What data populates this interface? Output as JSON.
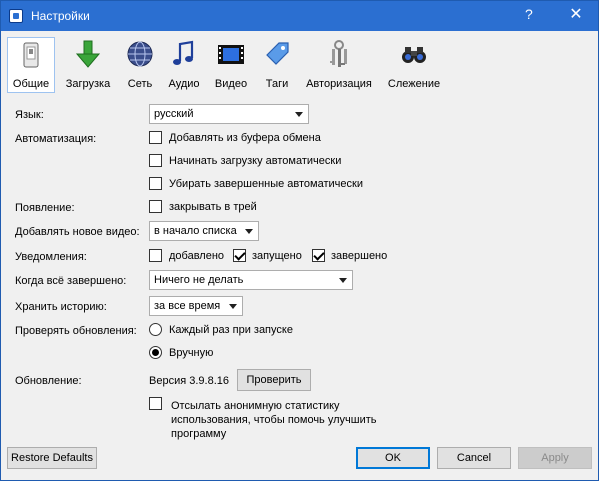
{
  "window": {
    "title": "Настройки",
    "help": "?",
    "close": "✕"
  },
  "tabs": [
    {
      "id": "general",
      "label": "Общие",
      "icon": "general-icon",
      "active": true
    },
    {
      "id": "download",
      "label": "Загрузка",
      "icon": "download-arrow-icon",
      "active": false
    },
    {
      "id": "network",
      "label": "Сеть",
      "icon": "globe-icon",
      "active": false
    },
    {
      "id": "audio",
      "label": "Аудио",
      "icon": "music-note-icon",
      "active": false
    },
    {
      "id": "video",
      "label": "Видео",
      "icon": "film-icon",
      "active": false
    },
    {
      "id": "tags",
      "label": "Таги",
      "icon": "tag-icon",
      "active": false
    },
    {
      "id": "auth",
      "label": "Авторизация",
      "icon": "keys-icon",
      "active": false
    },
    {
      "id": "tracking",
      "label": "Слежение",
      "icon": "binoculars-icon",
      "active": false
    }
  ],
  "settings": {
    "language": {
      "label": "Язык:",
      "value": "русский"
    },
    "automation": {
      "label": "Автоматизация:",
      "clipboard": {
        "label": "Добавлять из буфера обмена",
        "checked": false
      },
      "autostart": {
        "label": "Начинать загрузку автоматически",
        "checked": false
      },
      "autoremove": {
        "label": "Убирать завершенные автоматически",
        "checked": false
      }
    },
    "appearance": {
      "label": "Появление:",
      "tray": {
        "label": "закрывать в трей",
        "checked": false
      }
    },
    "add_video": {
      "label": "Добавлять новое видео:",
      "value": "в начало списка"
    },
    "notifications": {
      "label": "Уведомления:",
      "added": {
        "label": "добавлено",
        "checked": false
      },
      "started": {
        "label": "запущено",
        "checked": true
      },
      "finished": {
        "label": "завершено",
        "checked": true
      }
    },
    "when_done": {
      "label": "Когда всё завершено:",
      "value": "Ничего не делать"
    },
    "history": {
      "label": "Хранить историю:",
      "value": "за все время"
    },
    "updates": {
      "label": "Проверять обновления:",
      "every_start": {
        "label": "Каждый раз при запуске",
        "selected": false
      },
      "manual": {
        "label": "Вручную",
        "selected": true
      }
    },
    "version": {
      "label": "Обновление:",
      "text": "Версия 3.9.8.16",
      "check_button": "Проверить"
    },
    "stats": {
      "label": "Отсылать анонимную статистику использования, чтобы помочь улучшить программу",
      "checked": false
    }
  },
  "footer": {
    "restore": "Restore Defaults",
    "ok": "OK",
    "cancel": "Cancel",
    "apply": "Apply"
  }
}
